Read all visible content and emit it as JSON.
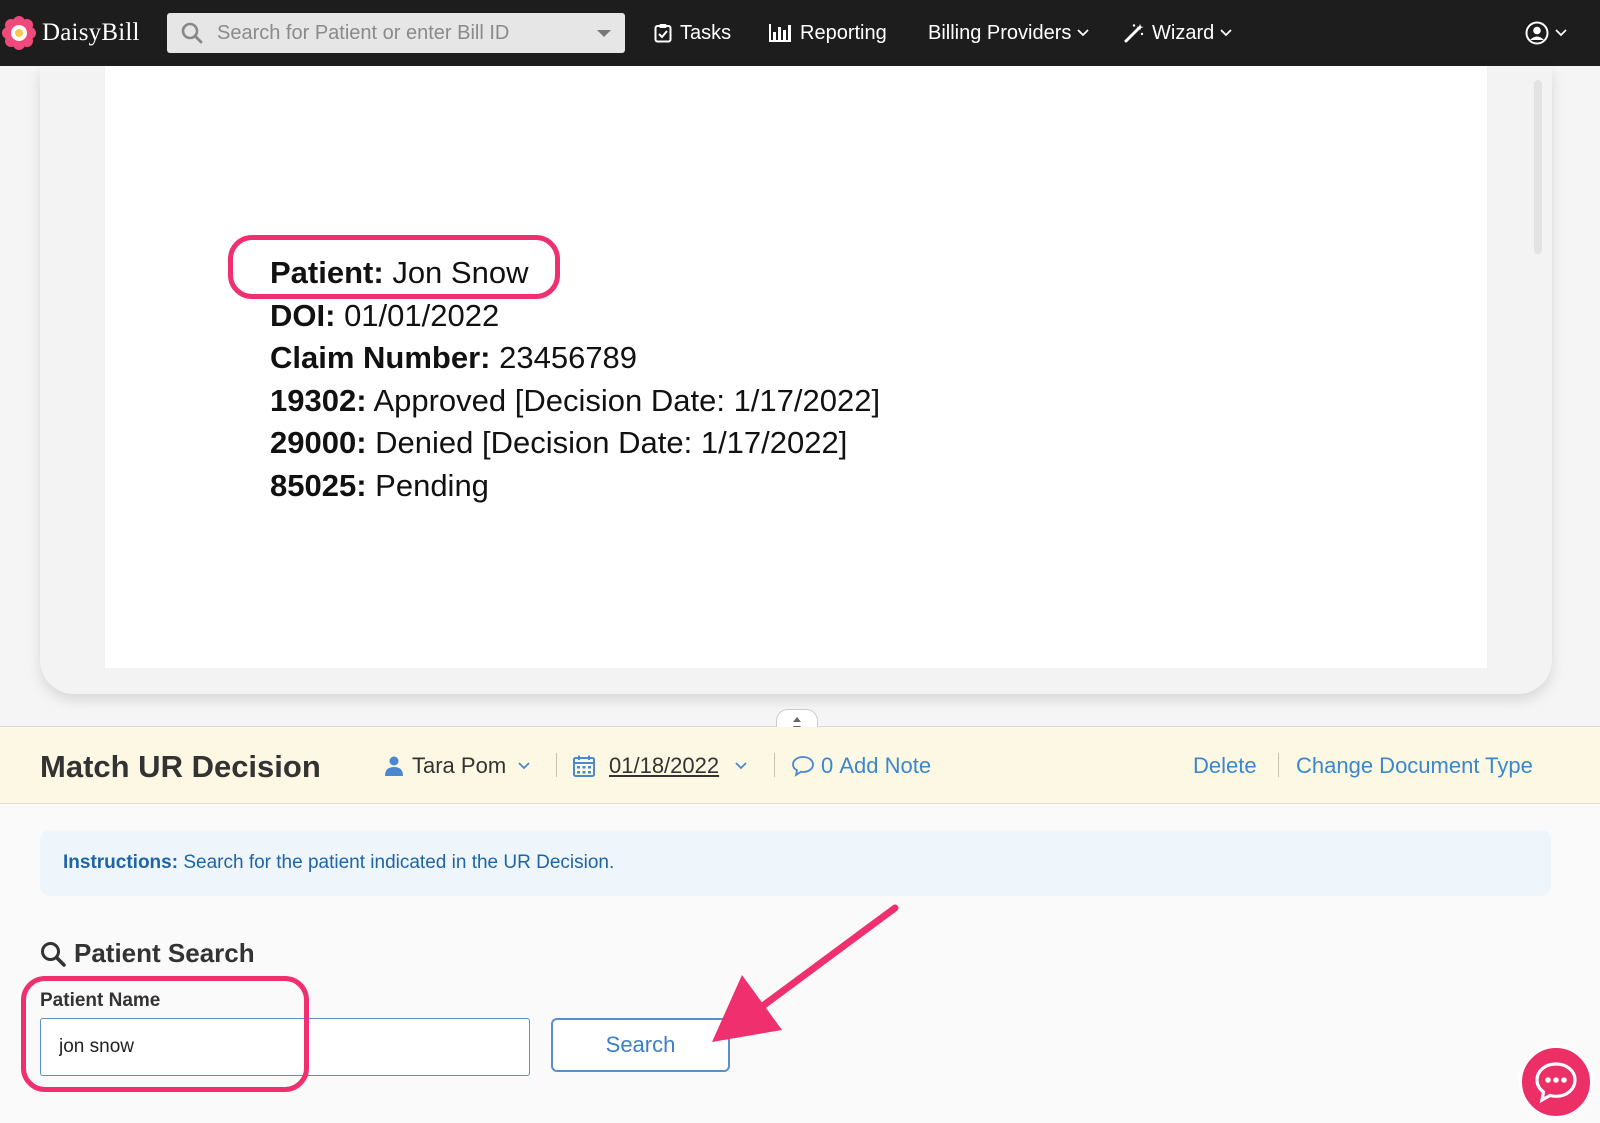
{
  "app": {
    "name": "DaisyBill"
  },
  "nav": {
    "search_placeholder": "Search for Patient or enter Bill ID",
    "tasks": "Tasks",
    "reporting": "Reporting",
    "billing_providers": "Billing Providers",
    "wizard": "Wizard"
  },
  "document": {
    "lines": [
      {
        "label": "Patient:",
        "value": "Jon Snow"
      },
      {
        "label": "DOI:",
        "value": "01/01/2022"
      },
      {
        "label": "Claim Number:",
        "value": "23456789"
      },
      {
        "label": "19302:",
        "value": "Approved [Decision Date: 1/17/2022]"
      },
      {
        "label": "29000:",
        "value": "Denied [Decision Date: 1/17/2022]"
      },
      {
        "label": "85025:",
        "value": "Pending"
      }
    ]
  },
  "header": {
    "title": "Match UR Decision",
    "assignee": "Tara Pom",
    "date": "01/18/2022",
    "note_count": "0",
    "add_note": "Add Note",
    "delete": "Delete",
    "change_type": "Change Document Type"
  },
  "instructions": {
    "label": "Instructions:",
    "text": "Search for the patient indicated in the UR Decision."
  },
  "patient_search": {
    "title": "Patient Search",
    "name_label": "Patient Name",
    "name_value": "jon snow",
    "button": "Search"
  },
  "colors": {
    "topbar": "#1d1d1d",
    "highlight": "#f0306e",
    "link": "#3a87d0",
    "header_bg": "#fcf8e3"
  },
  "icons": [
    "daisy-logo-icon",
    "search-icon",
    "tasks-icon",
    "reporting-icon",
    "wand-icon",
    "user-circle-icon",
    "user-icon",
    "calendar-icon",
    "comment-icon",
    "chat-icon",
    "resize-icon"
  ]
}
